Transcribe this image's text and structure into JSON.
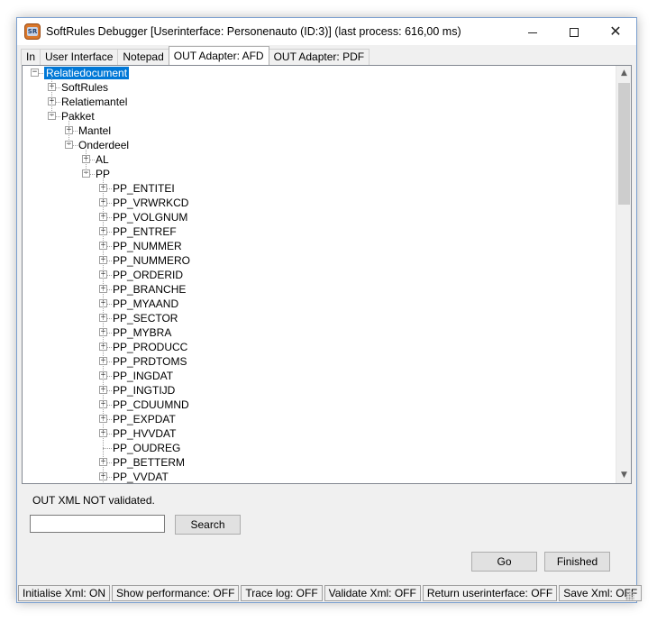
{
  "window": {
    "title": "SoftRules Debugger [Userinterface: Personenauto  (ID:3)] (last process: 616,00 ms)",
    "icon_label": "SR"
  },
  "tabs": [
    "In",
    "User Interface",
    "Notepad",
    "OUT Adapter: AFD",
    "OUT Adapter: PDF"
  ],
  "active_tab": "OUT Adapter: AFD",
  "tree": [
    {
      "label": "Relatiedocument",
      "level": 0,
      "expander": "-",
      "selected": true
    },
    {
      "label": "SoftRules",
      "level": 1,
      "expander": "+"
    },
    {
      "label": "Relatiemantel",
      "level": 1,
      "expander": "+"
    },
    {
      "label": "Pakket",
      "level": 1,
      "expander": "-"
    },
    {
      "label": "Mantel",
      "level": 2,
      "expander": "+"
    },
    {
      "label": "Onderdeel",
      "level": 2,
      "expander": "-"
    },
    {
      "label": "AL",
      "level": 3,
      "expander": "+"
    },
    {
      "label": "PP",
      "level": 3,
      "expander": "-"
    },
    {
      "label": "PP_ENTITEI",
      "level": 4,
      "expander": "+"
    },
    {
      "label": "PP_VRWRKCD",
      "level": 4,
      "expander": "+"
    },
    {
      "label": "PP_VOLGNUM",
      "level": 4,
      "expander": "+"
    },
    {
      "label": "PP_ENTREF",
      "level": 4,
      "expander": "+"
    },
    {
      "label": "PP_NUMMER",
      "level": 4,
      "expander": "+"
    },
    {
      "label": "PP_NUMMERO",
      "level": 4,
      "expander": "+"
    },
    {
      "label": "PP_ORDERID",
      "level": 4,
      "expander": "+"
    },
    {
      "label": "PP_BRANCHE",
      "level": 4,
      "expander": "+"
    },
    {
      "label": "PP_MYAAND",
      "level": 4,
      "expander": "+"
    },
    {
      "label": "PP_SECTOR",
      "level": 4,
      "expander": "+"
    },
    {
      "label": "PP_MYBRA",
      "level": 4,
      "expander": "+"
    },
    {
      "label": "PP_PRODUCC",
      "level": 4,
      "expander": "+"
    },
    {
      "label": "PP_PRDTOMS",
      "level": 4,
      "expander": "+"
    },
    {
      "label": "PP_INGDAT",
      "level": 4,
      "expander": "+"
    },
    {
      "label": "PP_INGTIJD",
      "level": 4,
      "expander": "+"
    },
    {
      "label": "PP_CDUUMND",
      "level": 4,
      "expander": "+"
    },
    {
      "label": "PP_EXPDAT",
      "level": 4,
      "expander": "+"
    },
    {
      "label": "PP_HVVDAT",
      "level": 4,
      "expander": "+"
    },
    {
      "label": "PP_OUDREG",
      "level": 4,
      "expander": ""
    },
    {
      "label": "PP_BETTERM",
      "level": 4,
      "expander": "+"
    },
    {
      "label": "PP_VVDAT",
      "level": 4,
      "expander": "+"
    }
  ],
  "validation_message": "OUT XML NOT validated.",
  "search": {
    "value": "",
    "button_label": "Search"
  },
  "buttons": {
    "go": "Go",
    "finished": "Finished"
  },
  "statusbar": [
    "Initialise Xml: ON",
    "Show performance: OFF",
    "Trace log: OFF",
    "Validate Xml: OFF",
    "Return userinterface: OFF",
    "Save Xml: OFF"
  ]
}
